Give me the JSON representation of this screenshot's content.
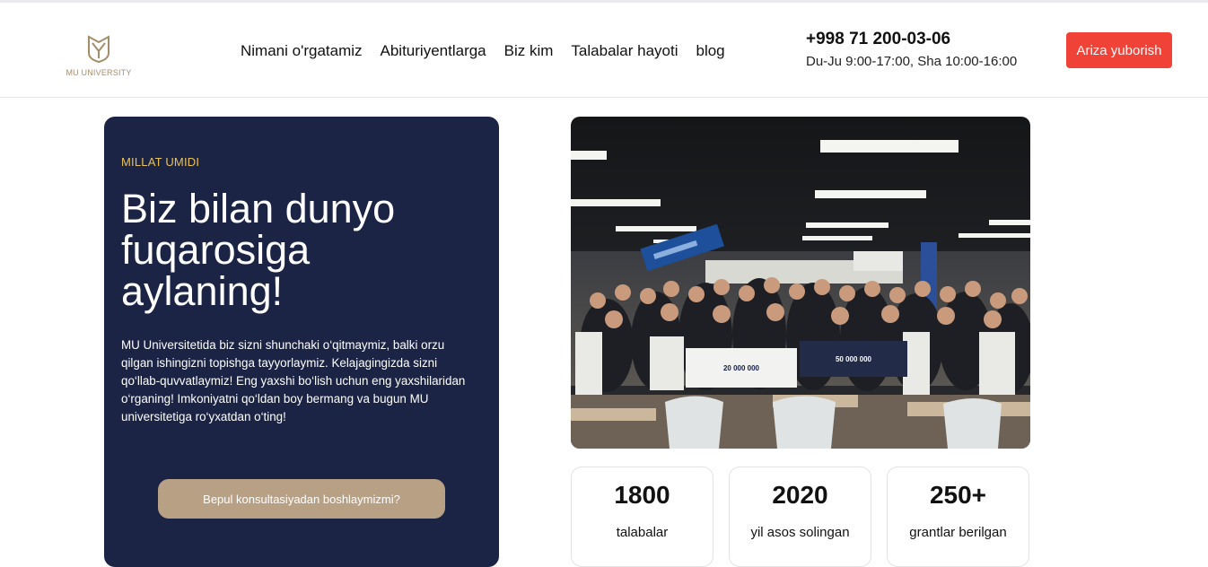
{
  "brand": {
    "name": "MU UNIVERSITY",
    "accent": "#a58d6c"
  },
  "nav": {
    "items": [
      {
        "label": "Nimani o'rgatamiz"
      },
      {
        "label": "Abituriyentlarga"
      },
      {
        "label": "Biz kim"
      },
      {
        "label": "Talabalar hayoti"
      },
      {
        "label": "blog"
      }
    ]
  },
  "contact": {
    "phone": "+998 71 200-03-06",
    "hours": "Du-Ju 9:00-17:00, Sha 10:00-16:00"
  },
  "header_cta": {
    "label": "Ariza yuborish",
    "color": "#f04237"
  },
  "hero": {
    "eyebrow": "MILLAT UMIDI",
    "title": "Biz bilan dunyo fuqarosiga aylaning!",
    "description": "MU Universitetida biz sizni shunchaki o‘qitmaymiz, balki orzu qilgan ishingizni topishga tayyorlaymiz. Kelajagingizda sizni qo‘llab-quvvatlaymiz! Eng yaxshi bo‘lish uchun eng yaxshilaridan o‘rganing! Imkoniyatni qo‘ldan boy bermang va bugun MU universitetiga ro‘yxatdan o‘ting!",
    "cta_label": "Bepul konsultasiyadan boshlaymizmi?",
    "background": "#1b2445"
  },
  "photo": {
    "cheque_left": "20 000 000",
    "cheque_right": "50 000 000"
  },
  "stats": [
    {
      "value": "1800",
      "label": "talabalar"
    },
    {
      "value": "2020",
      "label": "yil asos solingan"
    },
    {
      "value": "250+",
      "label": "grantlar berilgan"
    }
  ]
}
